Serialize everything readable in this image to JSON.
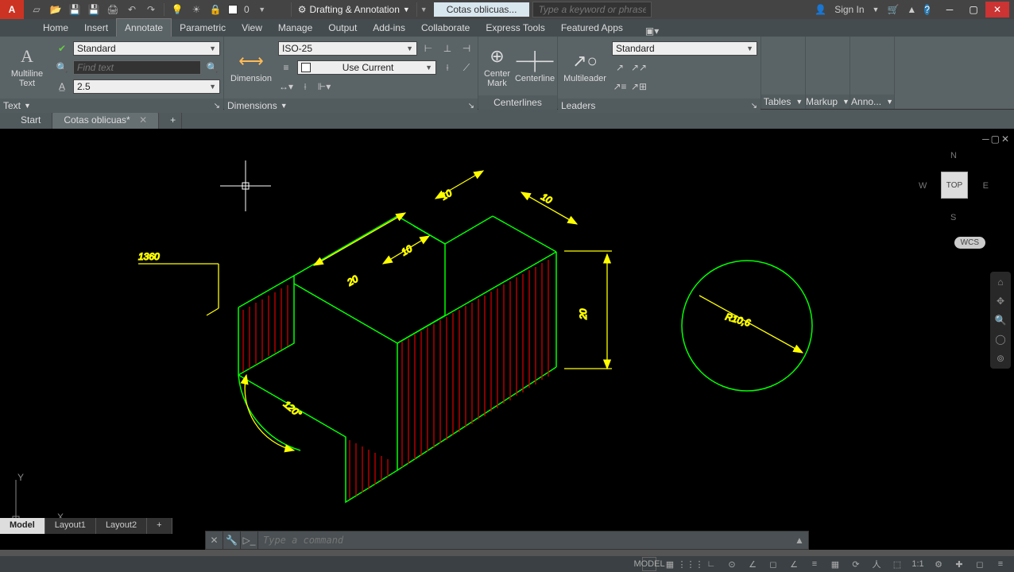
{
  "title": {
    "workspace": "Drafting & Annotation",
    "doc": "Cotas oblicuas...",
    "search_ph": "Type a keyword or phrase",
    "sign_in": "Sign In",
    "layer_number": "0"
  },
  "ribbon_tabs": [
    "Home",
    "Insert",
    "Annotate",
    "Parametric",
    "View",
    "Manage",
    "Output",
    "Add-ins",
    "Collaborate",
    "Express Tools",
    "Featured Apps"
  ],
  "ribbon": {
    "text": {
      "big": "Multiline\nText",
      "style": "Standard",
      "find_ph": "Find text",
      "height": "2.5",
      "title": "Text"
    },
    "dim": {
      "big": "Dimension",
      "style": "ISO-25",
      "layer": "Use Current",
      "title": "Dimensions"
    },
    "center": {
      "mark": "Center\nMark",
      "line": "Centerline",
      "title": "Centerlines"
    },
    "leader": {
      "big": "Multileader",
      "style": "Standard",
      "title": "Leaders"
    },
    "tables": "Tables",
    "markup": "Markup",
    "anno": "Anno..."
  },
  "doc_tabs": {
    "start": "Start",
    "file": "Cotas oblicuas*"
  },
  "cmd_ph": "Type a command",
  "layout_tabs": [
    "Model",
    "Layout1",
    "Layout2"
  ],
  "status": {
    "model": "MODEL",
    "scale": "1:1"
  },
  "nav": {
    "top": "TOP",
    "n": "N",
    "s": "S",
    "e": "E",
    "w": "W",
    "wcs": "WCS"
  },
  "ucs": {
    "y": "Y",
    "x": "X"
  },
  "drawing": {
    "d1": "1360",
    "d2": "20",
    "d3": "10",
    "d4": "10",
    "d5": "10",
    "d6": "20",
    "ang": "120°",
    "rad": "R10,6"
  }
}
